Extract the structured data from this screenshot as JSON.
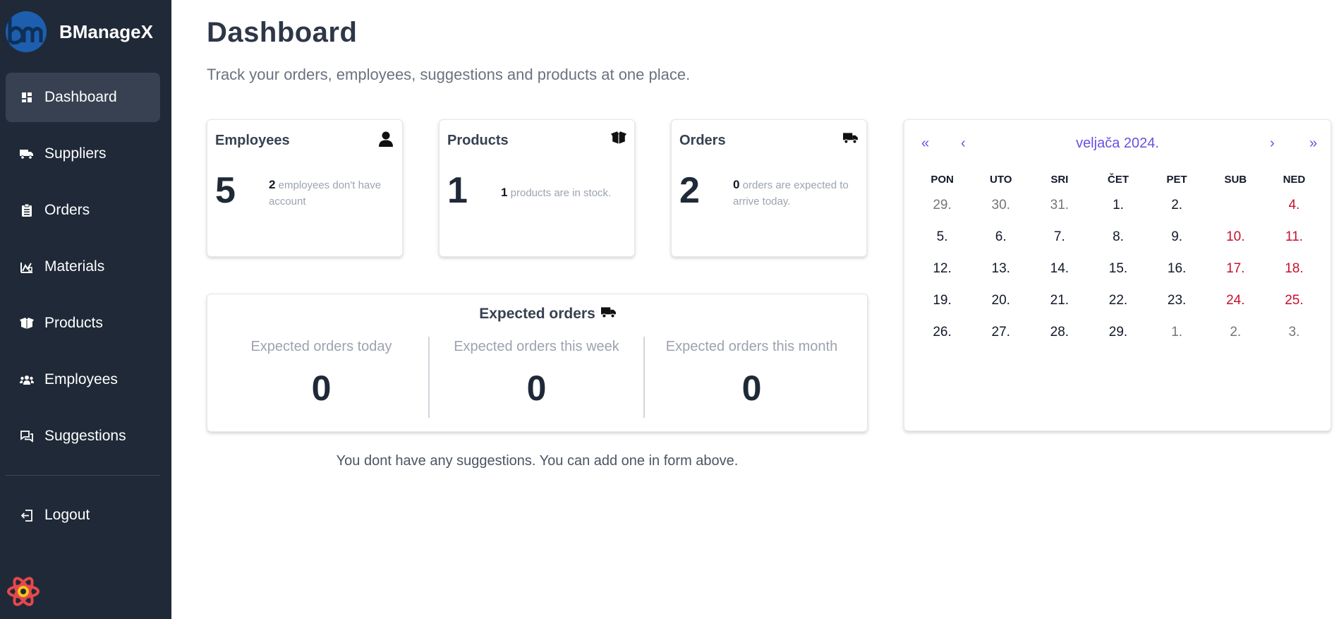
{
  "brand": {
    "name": "BManageX"
  },
  "sidebar": {
    "items": [
      {
        "label": "Dashboard",
        "icon": "dashboard-icon",
        "active": true
      },
      {
        "label": "Suppliers",
        "icon": "truck-icon"
      },
      {
        "label": "Orders",
        "icon": "clipboard-icon"
      },
      {
        "label": "Materials",
        "icon": "materials-icon"
      },
      {
        "label": "Products",
        "icon": "box-icon"
      },
      {
        "label": "Employees",
        "icon": "users-icon"
      },
      {
        "label": "Suggestions",
        "icon": "chat-icon"
      }
    ],
    "logout": "Logout"
  },
  "header": {
    "title": "Dashboard",
    "subtitle": "Track your orders, employees, suggestions and products at one place."
  },
  "stats": {
    "employees": {
      "title": "Employees",
      "number": "5",
      "desc_count": "2",
      "desc_text": "employees don't have account"
    },
    "products": {
      "title": "Products",
      "number": "1",
      "desc_count": "1",
      "desc_text": "products are in stock."
    },
    "orders": {
      "title": "Orders",
      "number": "2",
      "desc_count": "0",
      "desc_text": "orders are expected to arrive today."
    }
  },
  "expected_orders": {
    "title": "Expected orders",
    "today_label": "Expected orders today",
    "today_value": "0",
    "week_label": "Expected orders this week",
    "week_value": "0",
    "month_label": "Expected orders this month",
    "month_value": "0"
  },
  "suggestions": {
    "empty_message": "You dont have any suggestions. You can add one in form above."
  },
  "calendar": {
    "month_label": "veljača 2024.",
    "nav": {
      "prev_year": "«",
      "prev_month": "‹",
      "next_month": "›",
      "next_year": "»"
    },
    "weekdays": [
      "PON",
      "UTO",
      "SRI",
      "ČET",
      "PET",
      "SUB",
      "NED"
    ],
    "weeks": [
      [
        "29.",
        "30.",
        "31.",
        "1.",
        "2.",
        "",
        "4."
      ],
      [
        "5.",
        "6.",
        "7.",
        "8.",
        "9.",
        "10.",
        "11."
      ],
      [
        "12.",
        "13.",
        "14.",
        "15.",
        "16.",
        "17.",
        "18."
      ],
      [
        "19.",
        "20.",
        "21.",
        "22.",
        "23.",
        "24.",
        "25."
      ],
      [
        "26.",
        "27.",
        "28.",
        "29.",
        "1.",
        "2.",
        "3."
      ]
    ],
    "colors": {
      "accent": "#6d4ee4",
      "weekend": "#c8102e",
      "outside_month": "#757575"
    }
  },
  "colors": {
    "sidebar_bg": "#1f2937",
    "active_item_bg": "#374151",
    "logo_bg": "#1d5fae"
  }
}
